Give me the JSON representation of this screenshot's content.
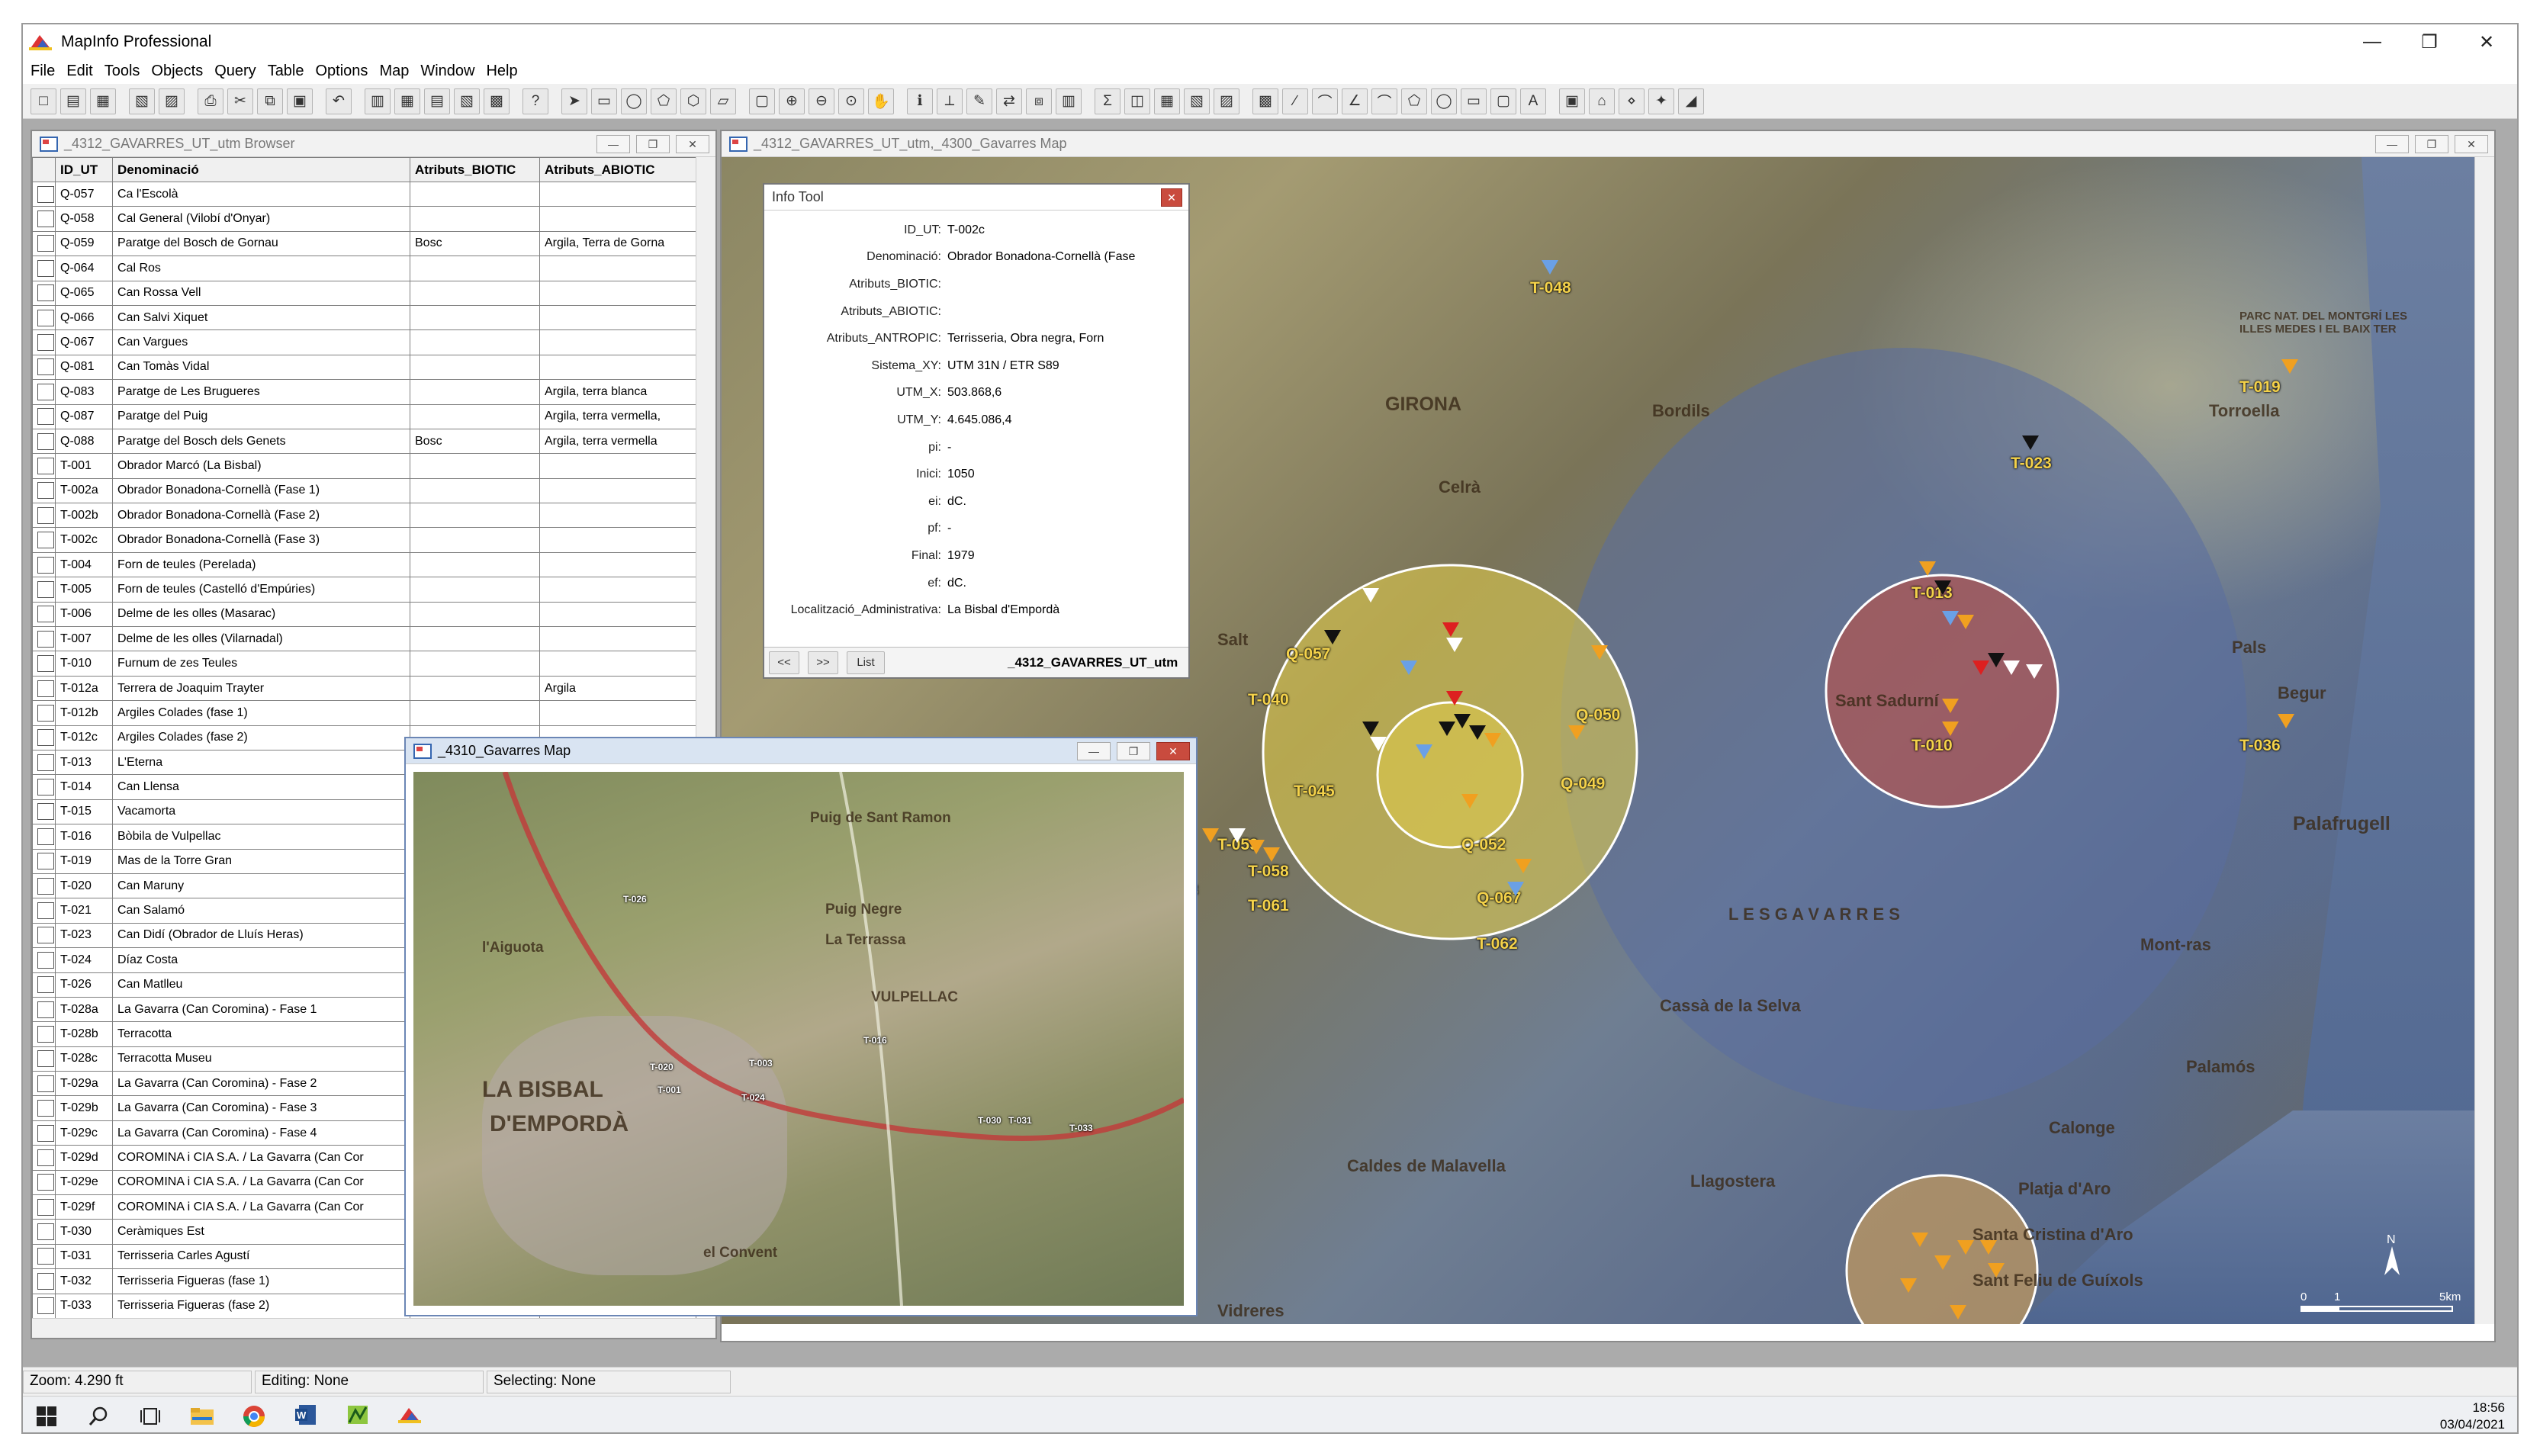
{
  "app": {
    "title": "MapInfo Professional"
  },
  "menu": [
    "File",
    "Edit",
    "Tools",
    "Objects",
    "Query",
    "Table",
    "Options",
    "Map",
    "Window",
    "Help"
  ],
  "browser": {
    "title": "_4312_GAVARRES_UT_utm Browser",
    "columns": [
      "ID_UT",
      "Denominació",
      "Atributs_BIOTIC",
      "Atributs_ABIOTIC"
    ],
    "rows": [
      [
        "Q-057",
        "Ca l'Escolà",
        "",
        ""
      ],
      [
        "Q-058",
        "Cal General (Vilobí d'Onyar)",
        "",
        ""
      ],
      [
        "Q-059",
        "Paratge del Bosch de Gornau",
        "Bosc",
        "Argila, Terra de Gorna"
      ],
      [
        "Q-064",
        "Cal Ros",
        "",
        ""
      ],
      [
        "Q-065",
        "Can Rossa Vell",
        "",
        ""
      ],
      [
        "Q-066",
        "Can Salvi Xiquet",
        "",
        ""
      ],
      [
        "Q-067",
        "Can Vargues",
        "",
        ""
      ],
      [
        "Q-081",
        "Can Tomàs Vidal",
        "",
        ""
      ],
      [
        "Q-083",
        "Paratge de Les Brugueres",
        "",
        "Argila, terra blanca"
      ],
      [
        "Q-087",
        "Paratge del Puig",
        "",
        "Argila, terra vermella,"
      ],
      [
        "Q-088",
        "Paratge del Bosch dels Genets",
        "Bosc",
        "Argila, terra vermella"
      ],
      [
        "T-001",
        "Obrador Marcó (La Bisbal)",
        "",
        ""
      ],
      [
        "T-002a",
        "Obrador Bonadona-Cornellà (Fase 1)",
        "",
        ""
      ],
      [
        "T-002b",
        "Obrador Bonadona-Cornellà (Fase 2)",
        "",
        ""
      ],
      [
        "T-002c",
        "Obrador Bonadona-Cornellà (Fase 3)",
        "",
        ""
      ],
      [
        "T-004",
        "Forn de teules (Perelada)",
        "",
        ""
      ],
      [
        "T-005",
        "Forn de teules (Castelló d'Empúries)",
        "",
        ""
      ],
      [
        "T-006",
        "Delme de les olles (Masarac)",
        "",
        ""
      ],
      [
        "T-007",
        "Delme de les olles (Vilarnadal)",
        "",
        ""
      ],
      [
        "T-010",
        "Furnum de zes Teules",
        "",
        ""
      ],
      [
        "T-012a",
        "Terrera de Joaquim Trayter",
        "",
        "Argila"
      ],
      [
        "T-012b",
        "Argiles Colades (fase 1)",
        "",
        ""
      ],
      [
        "T-012c",
        "Argiles Colades (fase 2)",
        "",
        ""
      ],
      [
        "T-013",
        "L'Eterna",
        "",
        ""
      ],
      [
        "T-014",
        "Can Llensa",
        "",
        ""
      ],
      [
        "T-015",
        "Vacamorta",
        "",
        ""
      ],
      [
        "T-016",
        "Bòbila de Vulpellac",
        "",
        ""
      ],
      [
        "T-019",
        "Mas de la Torre Gran",
        "",
        ""
      ],
      [
        "T-020",
        "Can Maruny",
        "",
        ""
      ],
      [
        "T-021",
        "Can Salamó",
        "",
        ""
      ],
      [
        "T-023",
        "Can Didí (Obrador de Lluís Heras)",
        "",
        ""
      ],
      [
        "T-024",
        "Díaz Costa",
        "",
        ""
      ],
      [
        "T-026",
        "Can Matlleu",
        "",
        ""
      ],
      [
        "T-028a",
        "La Gavarra (Can Coromina) - Fase 1",
        "",
        ""
      ],
      [
        "T-028b",
        "Terracotta",
        "",
        ""
      ],
      [
        "T-028c",
        "Terracotta Museu",
        "",
        ""
      ],
      [
        "T-029a",
        "La Gavarra (Can Coromina) - Fase 2",
        "",
        ""
      ],
      [
        "T-029b",
        "La Gavarra (Can Coromina) - Fase 3",
        "",
        ""
      ],
      [
        "T-029c",
        "La Gavarra (Can Coromina) - Fase 4",
        "",
        ""
      ],
      [
        "T-029d",
        "COROMINA i CIA S.A. / La Gavarra (Can Cor",
        "",
        ""
      ],
      [
        "T-029e",
        "COROMINA i CIA S.A. / La Gavarra (Can Cor",
        "",
        ""
      ],
      [
        "T-029f",
        "COROMINA i CIA S.A. / La Gavarra (Can Cor",
        "",
        ""
      ],
      [
        "T-030",
        "Ceràmiques Est",
        "",
        ""
      ],
      [
        "T-031",
        "Terrisseria Carles Agustí",
        "",
        ""
      ],
      [
        "T-032",
        "Terrisseria Figueras (fase 1)",
        "",
        ""
      ],
      [
        "T-033",
        "Terrisseria Figueras (fase 2)",
        "",
        ""
      ]
    ]
  },
  "mainMap": {
    "title": "_4312_GAVARRES_UT_utm,_4300_Gavarres Map",
    "labels": [
      "T-048",
      "T-019",
      "T-023",
      "T-013",
      "T-010",
      "T-036",
      "Q-057",
      "T-040",
      "Q-050",
      "Q-049",
      "T-045",
      "Q-052",
      "T-059",
      "T-058",
      "T-061",
      "Q-067",
      "T-062",
      "058",
      "49"
    ],
    "places": [
      "GIRONA",
      "Palafrugell",
      "Palamós",
      "Platja d'Aro",
      "Sant Feliu de Guíxols",
      "Torroella",
      "Calonge",
      "Mont-ras",
      "Sant Sadurní",
      "Cassà de la Selva",
      "Llagostera",
      "Santa Cristina d'Aro",
      "Begur",
      "Salt",
      "Celrà",
      "Bordils",
      "Pals",
      "L E S   G A V A R R E S",
      "Vidreres",
      "Caldes de Malavella",
      "PARC NAT. DEL MONTGRÍ LES ILLES MEDES I EL BAIX TER"
    ],
    "scale": {
      "start": "0",
      "mid": "1",
      "end": "5km"
    },
    "north": "N"
  },
  "infoTool": {
    "title": "Info Tool",
    "rows": [
      [
        "ID_UT:",
        "T-002c"
      ],
      [
        "Denominació:",
        "Obrador Bonadona-Cornellà (Fase"
      ],
      [
        "Atributs_BIOTIC:",
        ""
      ],
      [
        "Atributs_ABIOTIC:",
        ""
      ],
      [
        "Atributs_ANTROPIC:",
        "Terrisseria, Obra negra, Forn"
      ],
      [
        "Sistema_XY:",
        "UTM 31N / ETR S89"
      ],
      [
        "UTM_X:",
        "503.868,6"
      ],
      [
        "UTM_Y:",
        "4.645.086,4"
      ],
      [
        "pi:",
        "-"
      ],
      [
        "Inici:",
        "1050"
      ],
      [
        "ei:",
        "dC."
      ],
      [
        "pf:",
        "-"
      ],
      [
        "Final:",
        "1979"
      ],
      [
        "ef:",
        "dC."
      ],
      [
        "Localització_Administrativa:",
        "La Bisbal d'Empordà"
      ]
    ],
    "footer": {
      "prev": "<<",
      "next": ">>",
      "list": "List",
      "table": "_4312_GAVARRES_UT_utm"
    }
  },
  "smallMap": {
    "title": "_4310_Gavarres Map",
    "places": [
      "LA BISBAL",
      "D'EMPORDÀ",
      "VULPELLAC",
      "Puig de Sant Ramon",
      "el Convent",
      "Puig Negre",
      "l'Aiguota",
      "La Terrassa"
    ],
    "labels": [
      "T-020",
      "T-001",
      "T-024",
      "T-003",
      "T-016",
      "T-030",
      "T-031",
      "T-033",
      "T-026"
    ]
  },
  "status": {
    "zoom": "Zoom: 4.290 ft",
    "editing": "Editing: None",
    "selecting": "Selecting: None"
  },
  "clock": {
    "time": "18:56",
    "date": "03/04/2021"
  },
  "colors": {
    "orangeMarker": "#f0a020",
    "blackMarker": "#111111",
    "redMarker": "#dd2020",
    "blueMarker": "#6aa0e6",
    "whiteMarker": "#ffffff",
    "yellowBuffer": "#e8d24a",
    "redBuffer": "#c84a3a"
  }
}
